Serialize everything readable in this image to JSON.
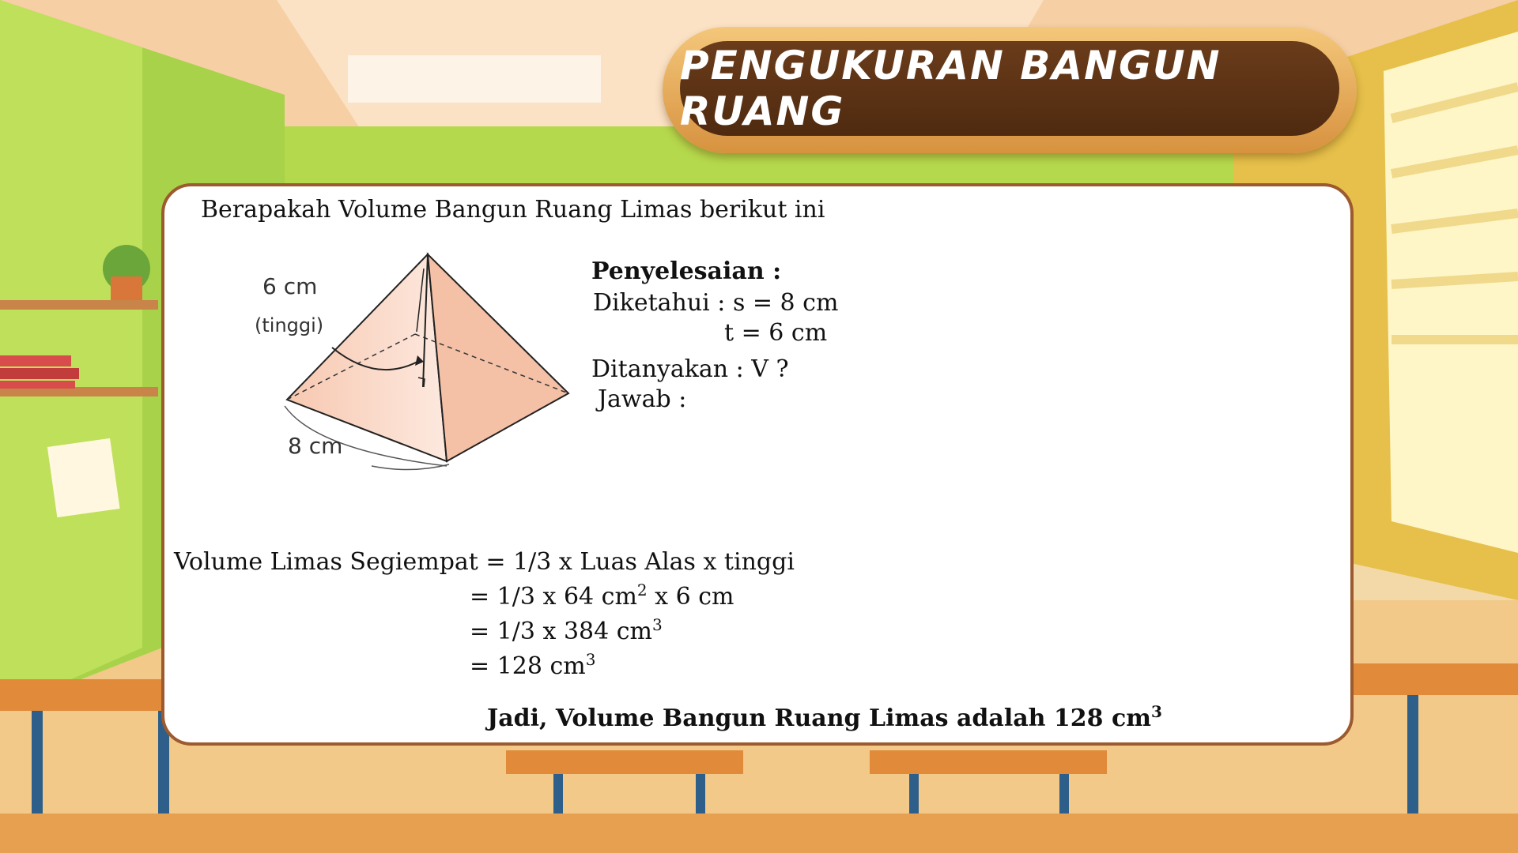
{
  "title": "PENGUKURAN BANGUN RUANG",
  "question": "Berapakah Volume Bangun Ruang Limas  berikut ini",
  "figure": {
    "height_label": "6 cm",
    "height_note": "(tinggi)",
    "base_label": "8 cm"
  },
  "solution": {
    "heading": "Penyelesaian :",
    "known_1": "Diketahui : s = 8 cm",
    "known_2": "t = 6 cm",
    "asked": "Ditanyakan : V ?",
    "answer": "Jawab :"
  },
  "formula": {
    "line_1": "Volume Limas Segiempat = 1/3 x Luas Alas x tinggi",
    "line_2_a": "= 1/3 x 64 cm",
    "line_2_sup": "2",
    "line_2_b": " x 6 cm",
    "line_3": "= 1/3  x 384 cm",
    "line_3_sup": "3",
    "line_4": "= 128 cm",
    "line_4_sup": "3"
  },
  "conclusion": {
    "text": "Jadi, Volume Bangun Ruang Limas adalah 128 cm",
    "sup": "3"
  }
}
